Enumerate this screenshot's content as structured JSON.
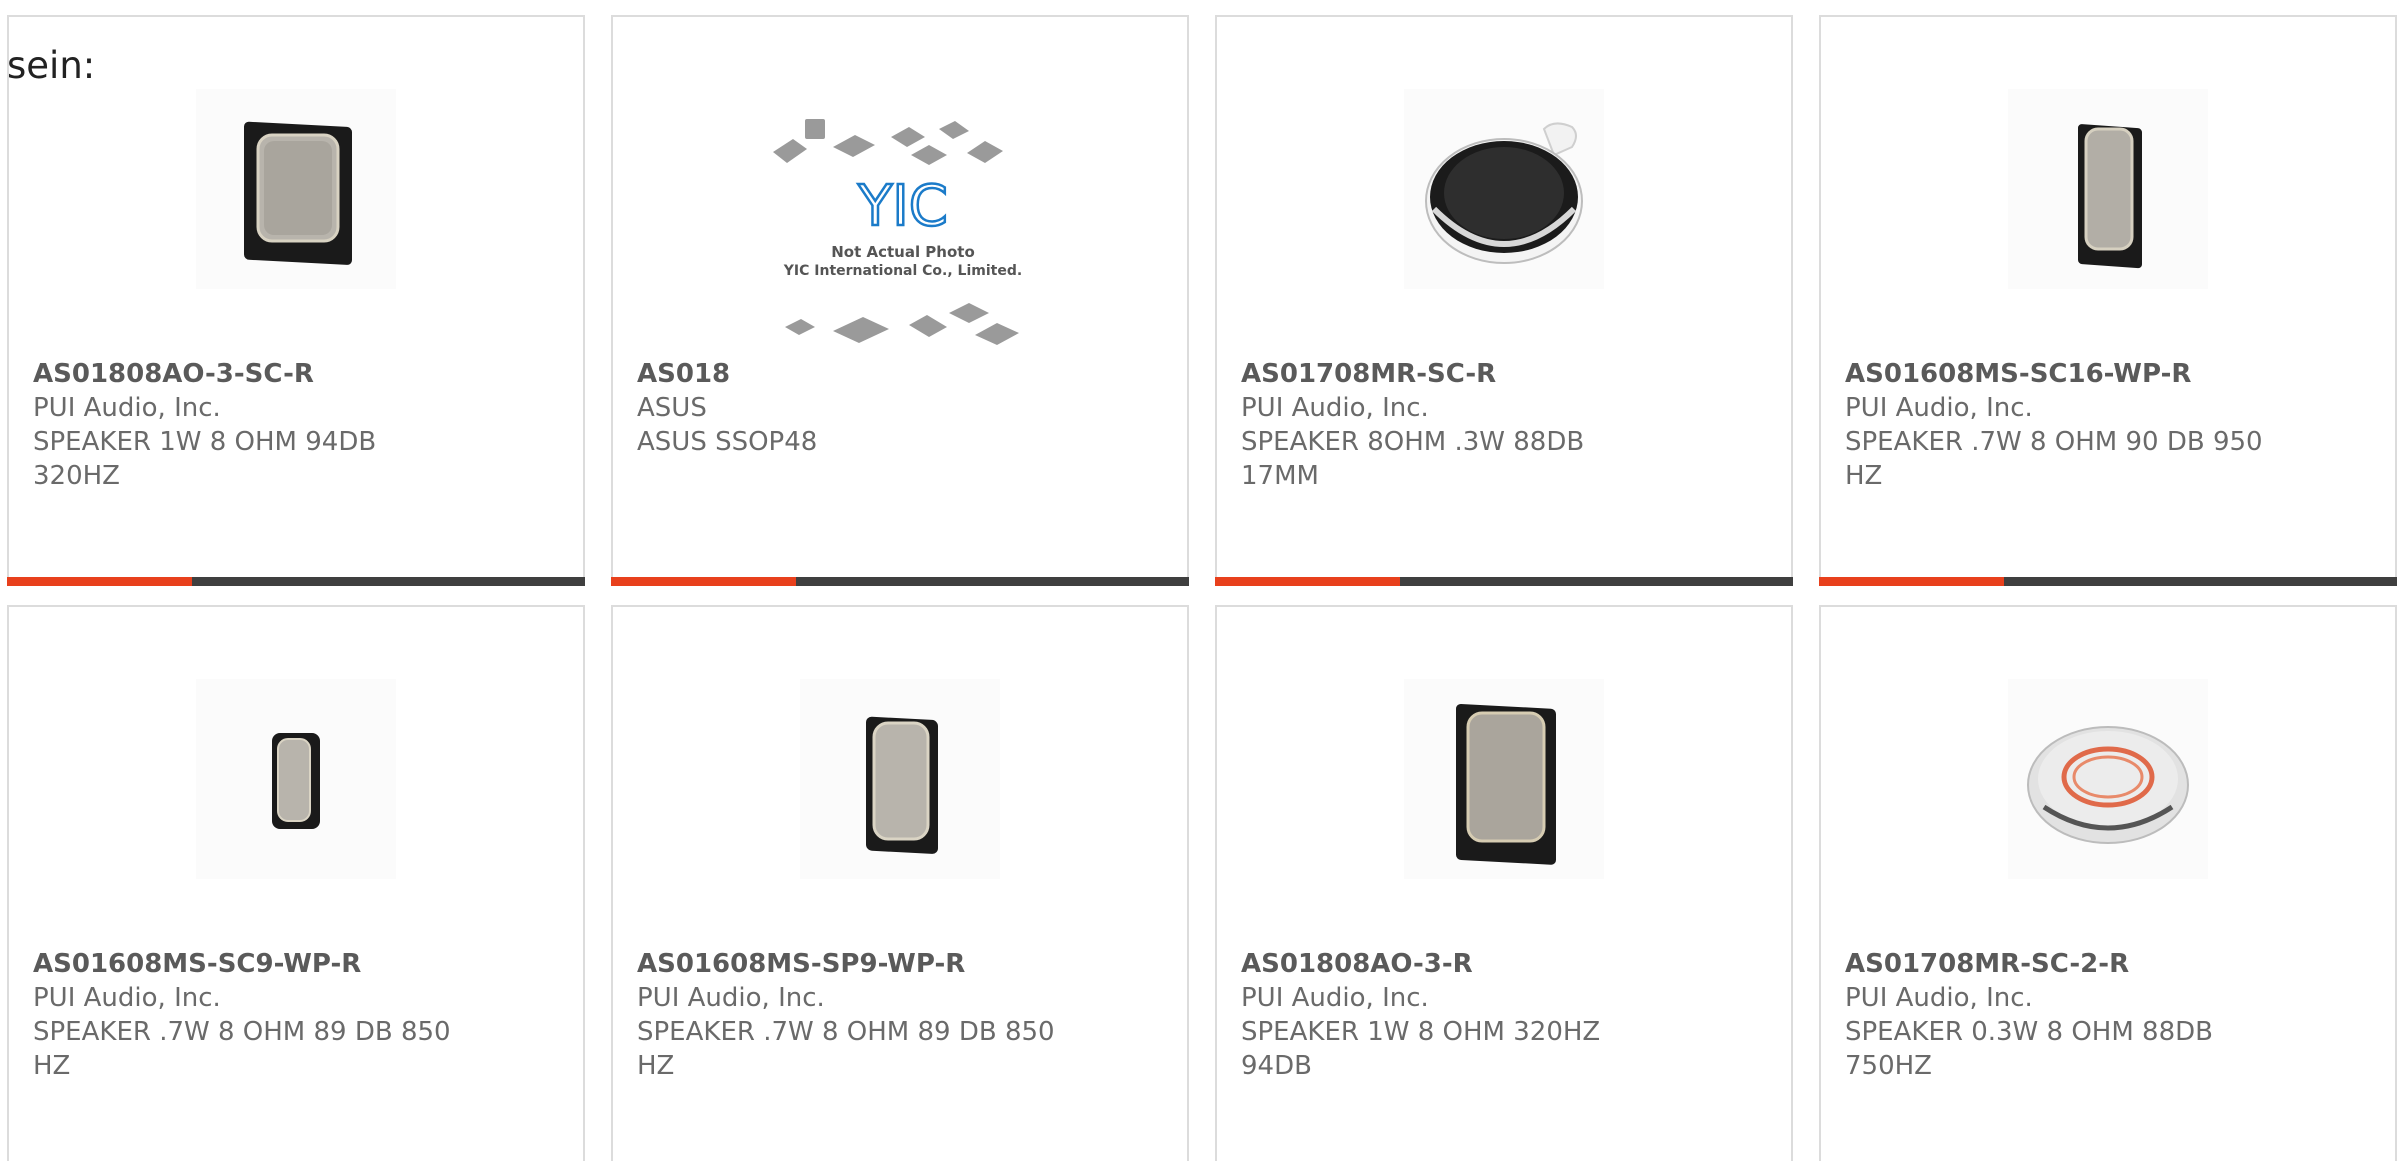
{
  "stray_text": "sein:",
  "products": [
    {
      "part_number": "AS01808AO-3-SC-R",
      "manufacturer": "PUI Audio, Inc.",
      "description": "SPEAKER 1W 8 OHM 94DB 320HZ",
      "image_icon": "rectangular-speaker-icon",
      "progress_fraction": 0.32
    },
    {
      "part_number": "AS018",
      "manufacturer": "ASUS",
      "description": "ASUS SSOP48",
      "image_icon": "yic-placeholder-image",
      "image_brand": "YIC",
      "image_caption_line1": "Not Actual Photo",
      "image_caption_line2": "YIC International Co., Limited.",
      "progress_fraction": 0.32
    },
    {
      "part_number": "AS01708MR-SC-R",
      "manufacturer": "PUI Audio, Inc.",
      "description": "SPEAKER 8OHM .3W 88DB 17MM",
      "image_icon": "round-speaker-icon",
      "progress_fraction": 0.32
    },
    {
      "part_number": "AS01608MS-SC16-WP-R",
      "manufacturer": "PUI Audio, Inc.",
      "description": "SPEAKER .7W 8 OHM 90 DB 950 HZ",
      "image_icon": "narrow-speaker-icon",
      "progress_fraction": 0.32
    },
    {
      "part_number": "AS01608MS-SC9-WP-R",
      "manufacturer": "PUI Audio, Inc.",
      "description": "SPEAKER .7W 8 OHM 89 DB 850 HZ",
      "image_icon": "small-speaker-icon"
    },
    {
      "part_number": "AS01608MS-SP9-WP-R",
      "manufacturer": "PUI Audio, Inc.",
      "description": "SPEAKER .7W 8 OHM 89 DB 850 HZ",
      "image_icon": "rectangular-speaker-icon"
    },
    {
      "part_number": "AS01808AO-3-R",
      "manufacturer": "PUI Audio, Inc.",
      "description": "SPEAKER 1W 8 OHM 320HZ 94DB",
      "image_icon": "rectangular-speaker-icon"
    },
    {
      "part_number": "AS01708MR-SC-2-R",
      "manufacturer": "PUI Audio, Inc.",
      "description": "SPEAKER 0.3W 8 OHM 88DB 750HZ",
      "image_icon": "transparent-round-speaker-icon"
    }
  ],
  "colors": {
    "accent": "#e8401c",
    "track": "#3f3f3f",
    "border": "#dcdcdc",
    "text": "#6a6a6a"
  }
}
